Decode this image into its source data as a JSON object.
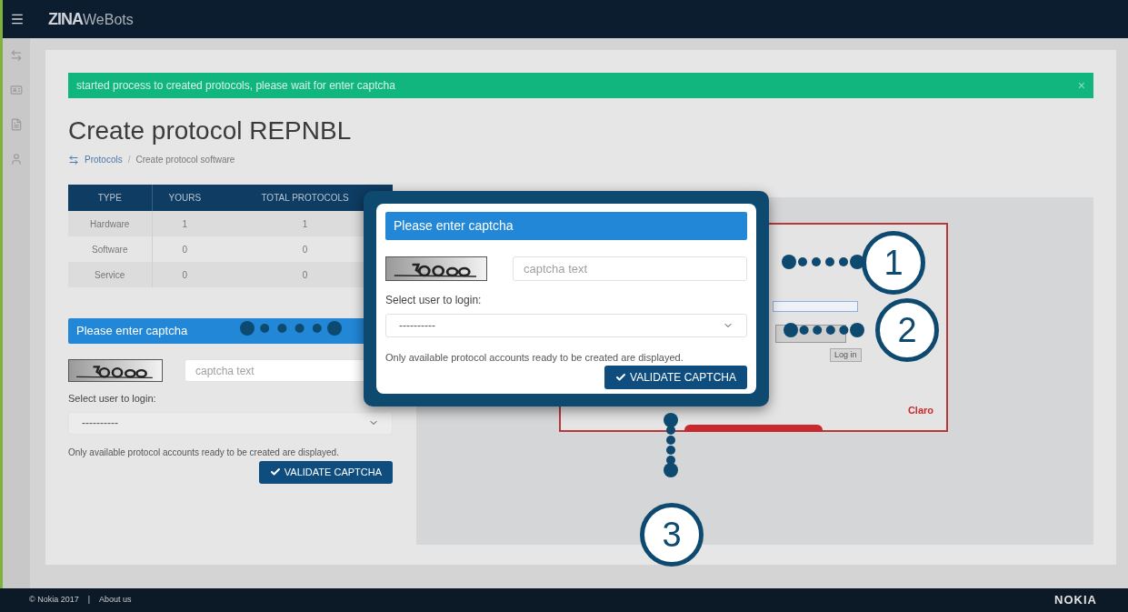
{
  "header": {
    "logo_bold": "ZINA",
    "logo_light": "WeBots"
  },
  "sidebar": {
    "items": [
      {
        "kind": "arrows"
      },
      {
        "kind": "card"
      },
      {
        "kind": "file"
      },
      {
        "kind": "user"
      }
    ]
  },
  "alert": {
    "text": "started process to created protocols, please wait for enter captcha",
    "close": "×"
  },
  "title": "Create protocol REPNBL",
  "breadcrumb": [
    {
      "label": "Protocols",
      "link": true
    },
    {
      "label": "Create protocol software",
      "link": false
    }
  ],
  "breadcrumb_separator": "/",
  "table": {
    "columns": [
      "TYPE",
      "YOURS",
      "TOTAL PROTOCOLS"
    ],
    "rows": [
      [
        "Hardware",
        "1",
        "1"
      ],
      [
        "Software",
        "0",
        "0"
      ],
      [
        "Service",
        "0",
        "0"
      ]
    ]
  },
  "captcha_form": {
    "header": "Please enter captcha",
    "placeholder": "captcha text",
    "select_label": "Select user to login:",
    "select_value": "----------",
    "note": "Only available protocol accounts ready to be created are displayed.",
    "button": "VALIDATE CAPTCHA"
  },
  "preview": {
    "login_button": "Log in",
    "brand": "Claro"
  },
  "modal": {
    "header": "Please enter captcha",
    "placeholder": "captcha text",
    "select_label": "Select user to login:",
    "select_value": "----------",
    "note": "Only available protocol accounts ready to be created are displayed.",
    "button": "VALIDATE CAPTCHA"
  },
  "callouts": [
    "1",
    "2",
    "3"
  ],
  "footer": {
    "copyright": "© Nokia 2017",
    "separator": "|",
    "link": "About us",
    "brand": "NOKIA"
  }
}
